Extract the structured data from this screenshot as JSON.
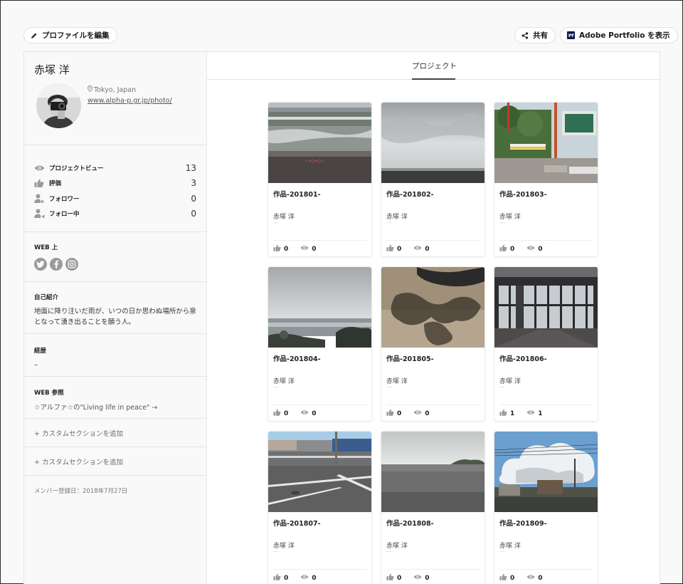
{
  "toolbar": {
    "edit_label": "プロファイルを編集",
    "share_label": "共有",
    "portfolio_badge": "Pf",
    "portfolio_label": "Adobe Portfolio を表示"
  },
  "profile": {
    "name": "赤塚 洋",
    "location": "Tokyo, Japan",
    "website": "www.alpha-p.gr.jp/photo/"
  },
  "stats": [
    {
      "label": "プロジェクトビュー",
      "value": "13",
      "icon": "eye-icon"
    },
    {
      "label": "評価",
      "value": "3",
      "icon": "thumbs-up-icon"
    },
    {
      "label": "フォロワー",
      "value": "0",
      "icon": "follower-icon"
    },
    {
      "label": "フォロー中",
      "value": "0",
      "icon": "following-icon"
    }
  ],
  "web": {
    "heading": "WEB 上",
    "icons": [
      "twitter-icon",
      "facebook-icon",
      "instagram-icon"
    ]
  },
  "bio": {
    "heading": "自己紹介",
    "text_line1": "地面に降り注いだ雨が、いつの日か思わぬ場所から泉",
    "text_line2": "となって湧き出ることを願う人。"
  },
  "career": {
    "heading": "経歴",
    "text": "–"
  },
  "reference": {
    "heading": "WEB 参照",
    "link": "☆アルファ☆の\"Living life in peace\" →"
  },
  "custom_sections": [
    "+ カスタムセクションを追加",
    "+ カスタムセクションを追加"
  ],
  "member_since": "メンバー登録日：2018年7月27日",
  "tabs": {
    "project": "プロジェクト"
  },
  "projects": [
    {
      "title": "作品-201801-",
      "author": "赤塚 洋",
      "dash": "—",
      "likes": "0",
      "views": "0"
    },
    {
      "title": "作品-201802-",
      "author": "赤塚 洋",
      "dash": "—",
      "likes": "0",
      "views": "0"
    },
    {
      "title": "作品-201803-",
      "author": "赤塚 洋",
      "dash": "—",
      "likes": "0",
      "views": "0"
    },
    {
      "title": "作品-201804-",
      "author": "赤塚 洋",
      "dash": "—",
      "likes": "0",
      "views": "0"
    },
    {
      "title": "作品-201805-",
      "author": "赤塚 洋",
      "dash": "—",
      "likes": "0",
      "views": "0"
    },
    {
      "title": "作品-201806-",
      "author": "赤塚 洋",
      "dash": "—",
      "likes": "1",
      "views": "1"
    },
    {
      "title": "作品-201807-",
      "author": "赤塚 洋",
      "dash": "—",
      "likes": "0",
      "views": "0"
    },
    {
      "title": "作品-201808-",
      "author": "赤塚 洋",
      "dash": "—",
      "likes": "0",
      "views": "0"
    },
    {
      "title": "作品-201809-",
      "author": "赤塚 洋",
      "dash": "—",
      "likes": "0",
      "views": "0"
    }
  ]
}
